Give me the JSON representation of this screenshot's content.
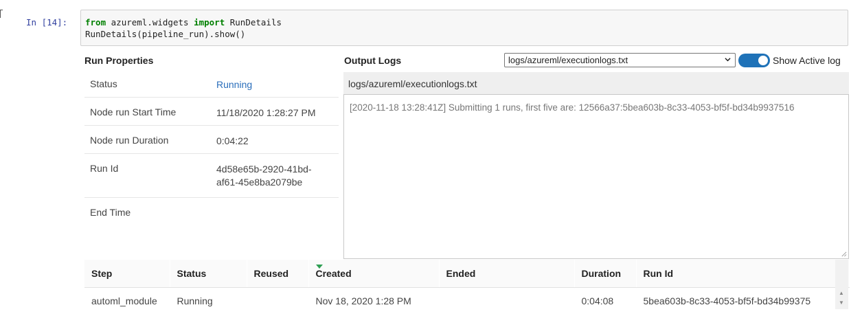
{
  "cell": {
    "prompt": "In [14]:",
    "code_line1": {
      "kw_from": "from",
      "module": "azureml.widgets",
      "kw_import": "import",
      "name": "RunDetails"
    },
    "code_line2": "RunDetails(pipeline_run).show()"
  },
  "run_properties": {
    "title": "Run Properties",
    "rows": [
      {
        "label": "Status",
        "value": "Running"
      },
      {
        "label": "Node run Start Time",
        "value": "11/18/2020 1:28:27 PM"
      },
      {
        "label": "Node run Duration",
        "value": "0:04:22"
      },
      {
        "label": "Run Id",
        "value": "4d58e65b-2920-41bd-af61-45e8ba2079be"
      },
      {
        "label": "End Time",
        "value": ""
      }
    ]
  },
  "output_logs": {
    "title": "Output Logs",
    "selected_log": "logs/azureml/executionlogs.txt",
    "toggle_label": "Show Active log",
    "toggle_on": true,
    "header": "logs/azureml/executionlogs.txt",
    "content": "[2020-11-18 13:28:41Z] Submitting 1 runs, first five are: 12566a37:5bea603b-8c33-4053-bf5f-bd34b9937516"
  },
  "steps_table": {
    "columns": [
      "Step",
      "Status",
      "Reused",
      "Created",
      "Ended",
      "Duration",
      "Run Id"
    ],
    "sorted_column": "Created",
    "rows": [
      {
        "step": "automl_module",
        "status": "Running",
        "reused": "",
        "created": "Nov 18, 2020 1:28 PM",
        "ended": "",
        "duration": "0:04:08",
        "run_id": "5bea603b-8c33-4053-bf5f-bd34b99375"
      }
    ]
  },
  "colors": {
    "link": "#2a6ebb",
    "toggle": "#1f72b8",
    "sort_arrow": "#2e9e52",
    "keyword": "#008000"
  }
}
